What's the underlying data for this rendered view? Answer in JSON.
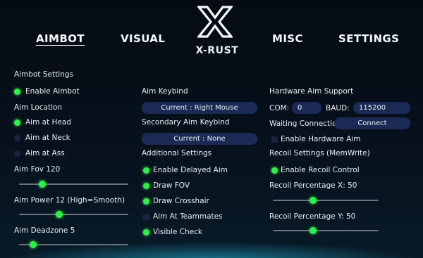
{
  "nav": {
    "tabs": [
      "AIMBOT",
      "VISUAL",
      "MISC",
      "SETTINGS"
    ],
    "active": "AIMBOT"
  },
  "brand": {
    "name": "X-RUST",
    "logo_icon": "x-logo-icon"
  },
  "col1": {
    "section_title": "Aimbot Settings",
    "enable_aimbot": {
      "label": "Enable Aimbot",
      "checked": true
    },
    "aim_location_title": "Aim Location",
    "aim_locations": [
      {
        "label": "Aim at Head",
        "selected": true
      },
      {
        "label": "Aim at Neck",
        "selected": false
      },
      {
        "label": "Aim at Ass",
        "selected": false
      }
    ],
    "aim_fov": {
      "label": "Aim Fov 120",
      "fraction": 0.21
    },
    "aim_power": {
      "label": "Aim Power 12 (High=Smooth)",
      "fraction": 0.37
    },
    "aim_deadzone": {
      "label": "Aim Deadzone 5",
      "fraction": 0.13
    }
  },
  "col2": {
    "aim_keybind_title": "Aim Keybind",
    "aim_keybind_value": "Current : Right Mouse",
    "secondary_keybind_title": "Secondary Aim Keybind",
    "secondary_keybind_value": "Current : None",
    "additional_title": "Additional Settings",
    "options": [
      {
        "label": "Enable Delayed Aim",
        "checked": true
      },
      {
        "label": "Draw FOV",
        "checked": true
      },
      {
        "label": "Draw Crosshair",
        "checked": true
      },
      {
        "label": "Aim At Teammates",
        "checked": false
      },
      {
        "label": "Visible Check",
        "checked": true
      }
    ]
  },
  "col3": {
    "hardware_title": "Hardware Aim Support",
    "com_label": "COM:",
    "com_value": "0",
    "baud_label": "BAUD:",
    "baud_value": "115200",
    "waiting_label": "Waiting Connection",
    "connect_label": "Connect",
    "enable_hardware": {
      "label": "Enable Hardware Aim",
      "checked": false
    },
    "recoil_title": "Recoil Settings (MemWrite)",
    "enable_recoil": {
      "label": "Enable Recoil Control",
      "checked": true
    },
    "recoil_x": {
      "label": "Recoil Percentage X: 50",
      "fraction": 0.38
    },
    "recoil_y": {
      "label": "Recoil Percentage Y: 50",
      "fraction": 0.38
    }
  },
  "colors": {
    "accent": "#2ef04a",
    "pill": "#1b2a55",
    "unchecked": "#1a2340"
  }
}
